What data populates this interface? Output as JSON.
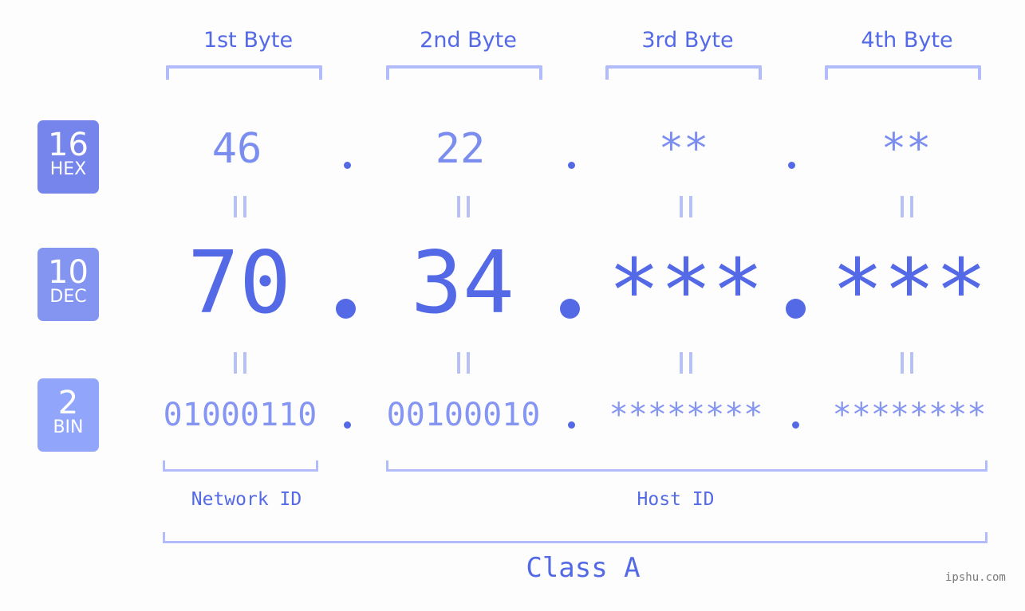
{
  "headers": [
    "1st Byte",
    "2nd Byte",
    "3rd Byte",
    "4th Byte"
  ],
  "rows": {
    "hex": {
      "base": "16",
      "label": "HEX",
      "octets": [
        "46",
        "22",
        "**",
        "**"
      ]
    },
    "dec": {
      "base": "10",
      "label": "DEC",
      "octets": [
        "70",
        "34",
        "***",
        "***"
      ]
    },
    "bin": {
      "base": "2",
      "label": "BIN",
      "octets": [
        "01000110",
        "00100010",
        "********",
        "********"
      ]
    }
  },
  "separator": ".",
  "network_id_label": "Network ID",
  "host_id_label": "Host ID",
  "class_label": "Class A",
  "watermark": "ipshu.com",
  "colors": {
    "accent": "#5469e6",
    "bracket": "#b2bcfa",
    "hex_badge": "#7585eb",
    "dec_badge": "#8494f1",
    "bin_badge": "#91a6fb"
  }
}
